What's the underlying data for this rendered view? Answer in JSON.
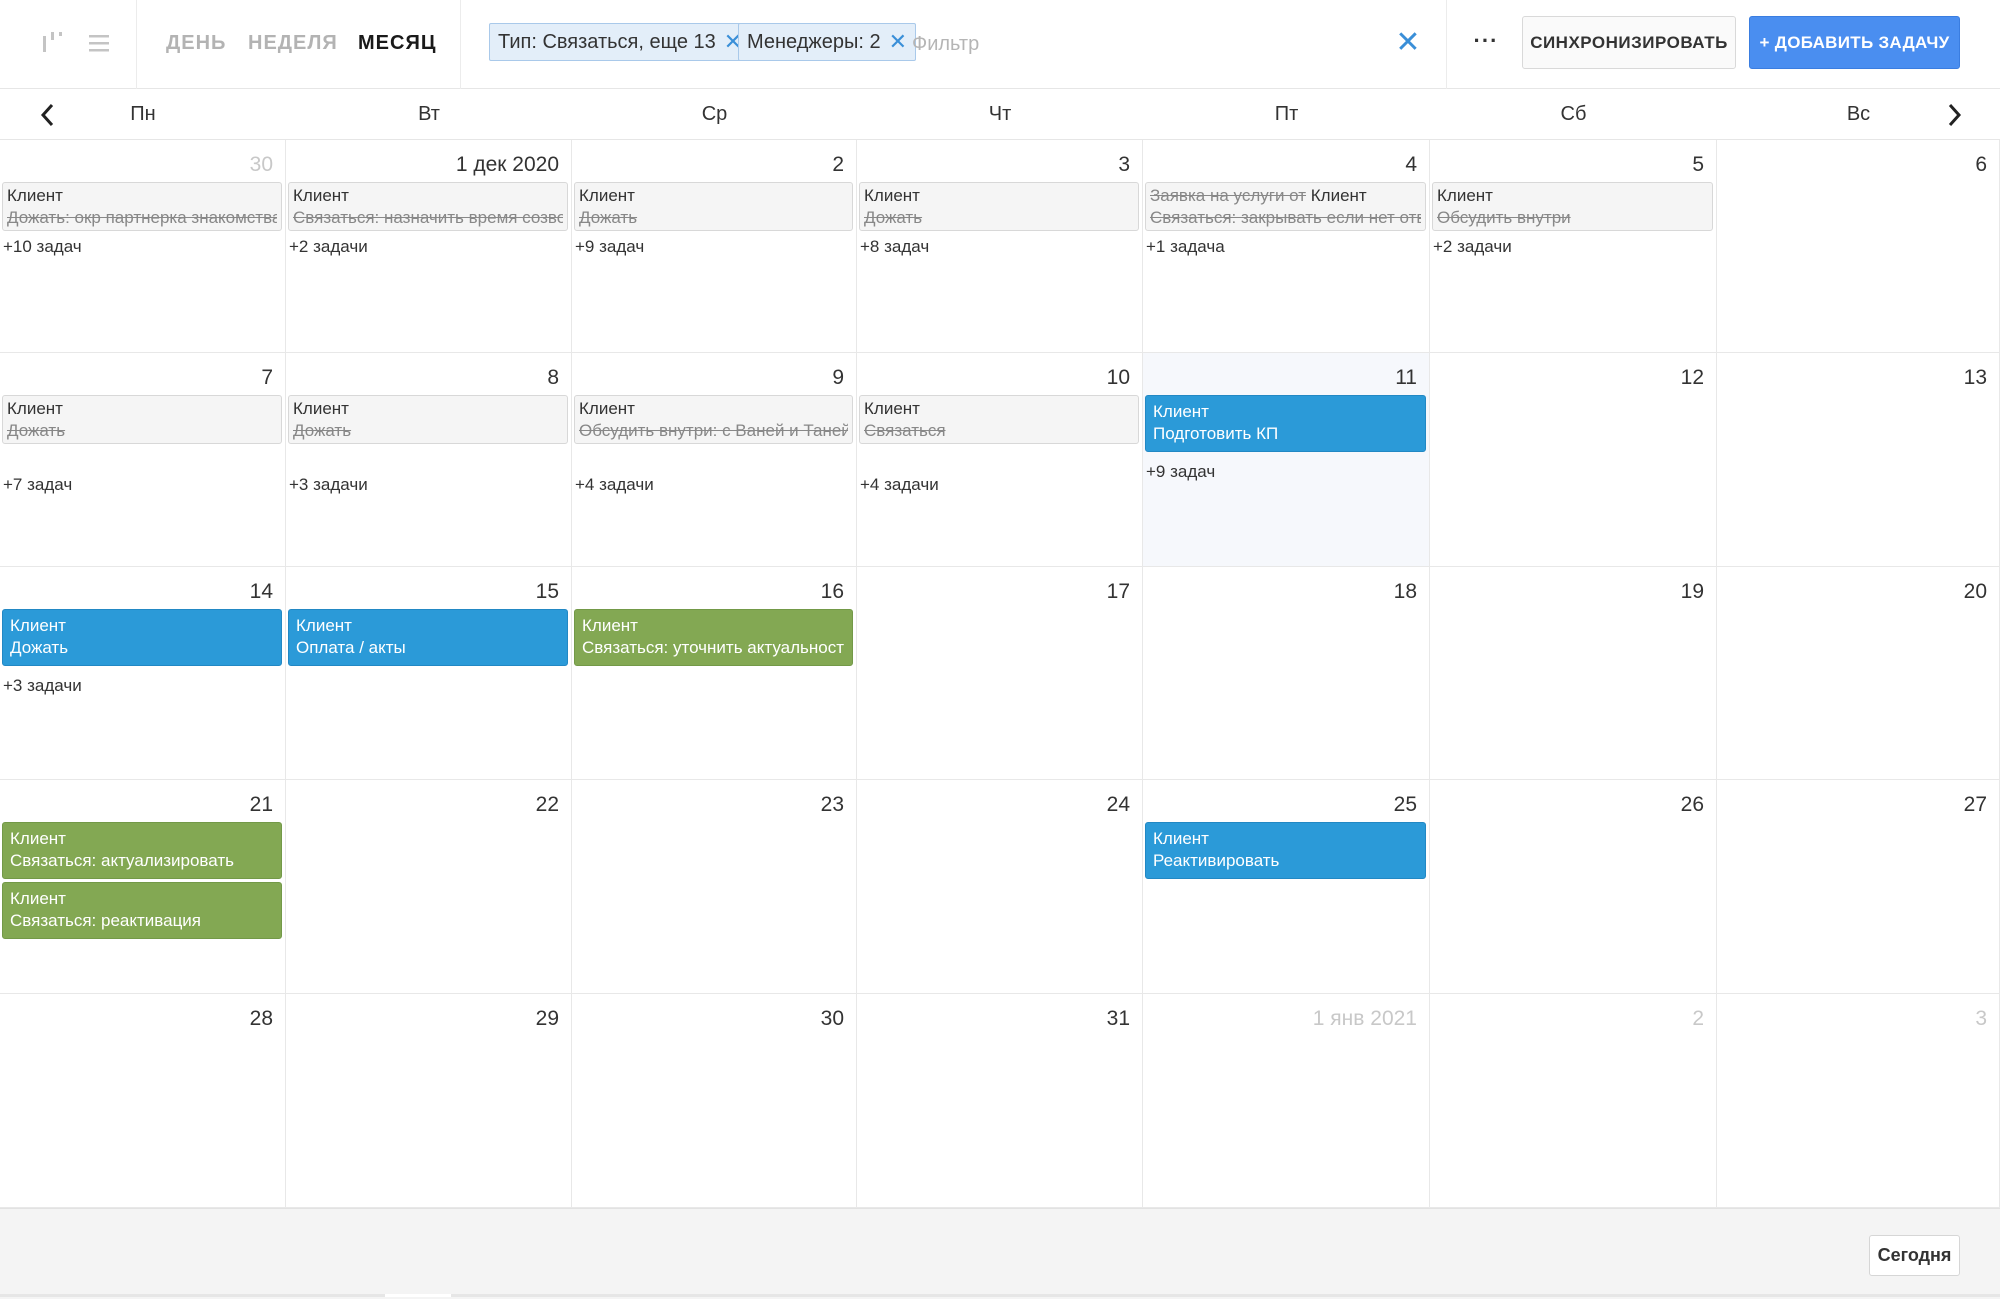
{
  "toolbar": {
    "views": [
      "ДЕНЬ",
      "НЕДЕЛЯ",
      "МЕСЯЦ"
    ],
    "active_view": "МЕСЯЦ",
    "chips": [
      {
        "label": "Тип: Связаться, еще 13"
      },
      {
        "label": "Менеджеры: 2"
      }
    ],
    "filter_placeholder": "Фильтр",
    "more_label": "···",
    "sync_label": "СИНХРОНИЗИРОВАТЬ",
    "add_label": "+ ДОБАВИТЬ ЗАДАЧУ"
  },
  "weekdays": [
    "Пн",
    "Вт",
    "Ср",
    "Чт",
    "Пт",
    "Сб",
    "Вс"
  ],
  "colors": {
    "accent": "#4a8ef0",
    "task_blue": "#2b9ad8",
    "task_green": "#83a853",
    "today_bg": "#f6f8fc"
  },
  "weeks": [
    [
      {
        "label": "30",
        "dim": true,
        "tasks": [
          {
            "client": "Клиент",
            "title": "Дожать: окр партнерка знакомства",
            "style": "grey"
          }
        ],
        "more": "+10 задач"
      },
      {
        "label": "1 дек 2020",
        "tasks": [
          {
            "client": "Клиент",
            "title": "Связаться: назначить время созвона",
            "style": "grey"
          }
        ],
        "more": "+2 задачи"
      },
      {
        "label": "2",
        "tasks": [
          {
            "client": "Клиент",
            "title": "Дожать",
            "style": "grey"
          }
        ],
        "more": "+9 задач"
      },
      {
        "label": "3",
        "tasks": [
          {
            "client": "Клиент",
            "title": "Дожать",
            "style": "grey"
          }
        ],
        "more": "+8 задач"
      },
      {
        "label": "4",
        "tasks": [
          {
            "prefix": "Заявка на услуги от",
            "client": "Клиент",
            "title": "Связаться: закрывать если нет ответа",
            "style": "grey"
          }
        ],
        "more": "+1 задача"
      },
      {
        "label": "5",
        "tasks": [
          {
            "client": "Клиент",
            "title": "Обсудить внутри",
            "style": "grey"
          }
        ],
        "more": "+2 задачи"
      },
      {
        "label": "6",
        "tasks": []
      }
    ],
    [
      {
        "label": "7",
        "tasks": [
          {
            "client": "Клиент",
            "title": "Дожать",
            "style": "grey"
          }
        ],
        "more": "+7 задач"
      },
      {
        "label": "8",
        "tasks": [
          {
            "client": "Клиент",
            "title": "Дожать",
            "style": "grey"
          }
        ],
        "more": "+3 задачи"
      },
      {
        "label": "9",
        "tasks": [
          {
            "client": "Клиент",
            "title": "Обсудить внутри: с Ваней и Таней К",
            "style": "grey"
          }
        ],
        "more": "+4 задачи"
      },
      {
        "label": "10",
        "tasks": [
          {
            "client": "Клиент",
            "title": "Связаться",
            "style": "grey"
          }
        ],
        "more": "+4 задачи"
      },
      {
        "label": "11",
        "today": true,
        "tasks": [
          {
            "client": "Клиент",
            "title": "Подготовить КП",
            "style": "blue"
          }
        ],
        "more": "+9 задач"
      },
      {
        "label": "12",
        "tasks": []
      },
      {
        "label": "13",
        "tasks": []
      }
    ],
    [
      {
        "label": "14",
        "tasks": [
          {
            "client": "Клиент",
            "title": "Дожать",
            "style": "blue"
          }
        ],
        "more": "+3 задачи"
      },
      {
        "label": "15",
        "tasks": [
          {
            "client": "Клиент",
            "title": "Оплата / акты",
            "style": "blue"
          }
        ]
      },
      {
        "label": "16",
        "tasks": [
          {
            "client": "Клиент",
            "title": "Связаться: уточнить актуальность",
            "style": "green"
          }
        ]
      },
      {
        "label": "17",
        "tasks": []
      },
      {
        "label": "18",
        "tasks": []
      },
      {
        "label": "19",
        "tasks": []
      },
      {
        "label": "20",
        "tasks": []
      }
    ],
    [
      {
        "label": "21",
        "tasks": [
          {
            "client": "Клиент",
            "title": "Связаться: актуализировать",
            "style": "green"
          },
          {
            "client": "Клиент",
            "title": "Связаться: реактивация",
            "style": "green"
          }
        ]
      },
      {
        "label": "22",
        "tasks": []
      },
      {
        "label": "23",
        "tasks": []
      },
      {
        "label": "24",
        "tasks": []
      },
      {
        "label": "25",
        "tasks": [
          {
            "client": "Клиент",
            "title": "Реактивировать",
            "style": "blue"
          }
        ]
      },
      {
        "label": "26",
        "tasks": []
      },
      {
        "label": "27",
        "tasks": []
      }
    ],
    [
      {
        "label": "28",
        "tasks": []
      },
      {
        "label": "29",
        "tasks": []
      },
      {
        "label": "30",
        "tasks": []
      },
      {
        "label": "31",
        "tasks": []
      },
      {
        "label": "1 янв 2021",
        "dim": true,
        "tasks": []
      },
      {
        "label": "2",
        "dim": true,
        "tasks": []
      },
      {
        "label": "3",
        "dim": true,
        "tasks": []
      }
    ]
  ],
  "footer": {
    "today_label": "Сегодня"
  }
}
